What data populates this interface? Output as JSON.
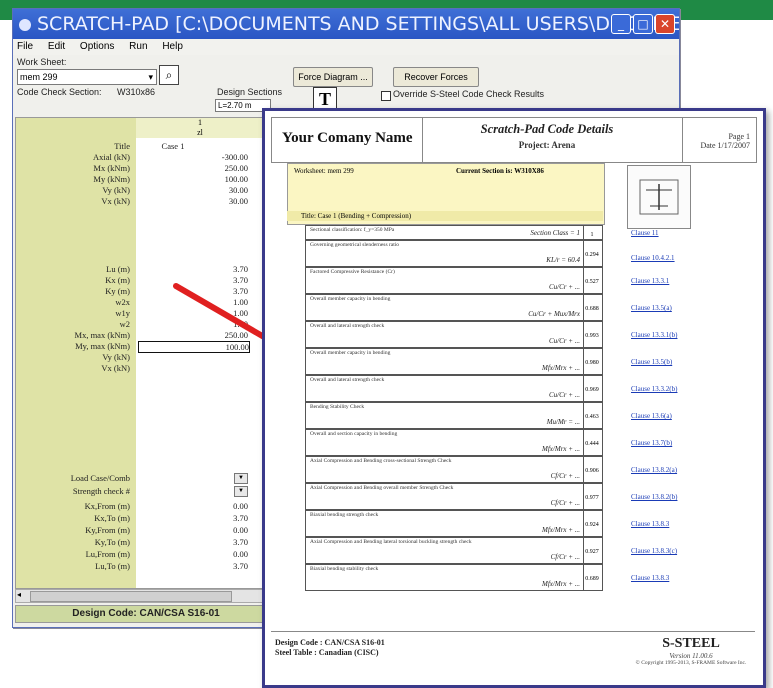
{
  "window": {
    "title": "SCRATCH-PAD [C:\\DOCUMENTS AND SETTINGS\\ALL USERS\\DOCUMENTS\\...",
    "menu": [
      "File",
      "Edit",
      "Options",
      "Run",
      "Help"
    ]
  },
  "toolbar": {
    "worksheet_label": "Work Sheet:",
    "worksheet_value": "mem 299",
    "code_check_section_label": "Code Check Section:",
    "code_check_section_value": "W310x86",
    "design_sections_label": "Design Sections",
    "design_sections_value": "L=2.70 m",
    "force_diagram": "Force Diagram ...",
    "recover_forces": "Recover Forces",
    "override_label": "Override S-Steel Code Check Results"
  },
  "grid": {
    "col_index": "1",
    "col_sub": "zl",
    "rows_top": [
      {
        "label": "Title",
        "value": "Case 1"
      },
      {
        "label": "Axial (kN)",
        "value": "-300.00"
      },
      {
        "label": "Mx (kNm)",
        "value": "250.00"
      },
      {
        "label": "My (kNm)",
        "value": "100.00"
      },
      {
        "label": "Vy (kN)",
        "value": "30.00"
      },
      {
        "label": "Vx (kN)",
        "value": "30.00"
      }
    ],
    "rows_mid": [
      {
        "label": "Lu (m)",
        "value": "3.70"
      },
      {
        "label": "Kx (m)",
        "value": "3.70"
      },
      {
        "label": "Ky (m)",
        "value": "3.70"
      },
      {
        "label": "w2x",
        "value": "1.00"
      },
      {
        "label": "w1y",
        "value": "1.00"
      },
      {
        "label": "w2",
        "value": "1.00"
      },
      {
        "label": "Mx, max (kNm)",
        "value": "250.00"
      },
      {
        "label": "My, max (kNm)",
        "value": "100.00"
      },
      {
        "label": "Vy (kN)",
        "value": ""
      },
      {
        "label": "Vx (kN)",
        "value": ""
      }
    ],
    "rows_bottom": [
      {
        "label": "Load Case/Comb",
        "value": ""
      },
      {
        "label": "Strength check #",
        "value": ""
      },
      {
        "label": "Kx,From (m)",
        "value": "0.00"
      },
      {
        "label": "Kx,To (m)",
        "value": "3.70"
      },
      {
        "label": "Ky,From (m)",
        "value": "0.00"
      },
      {
        "label": "Ky,To (m)",
        "value": "3.70"
      },
      {
        "label": "Lu,From (m)",
        "value": "0.00"
      },
      {
        "label": "Lu,To (m)",
        "value": "3.70"
      }
    ],
    "status": "Design Code: CAN/CSA S16-01"
  },
  "report": {
    "company": "Your Comany Name",
    "title": "Scratch-Pad Code Details",
    "subtitle": "Project: Arena",
    "page": "Page 1",
    "date": "Date 1/17/2007",
    "worksheet": "Worksheet: mem 299",
    "current_section": "Current Section is: W310X86",
    "case_title": "Title: Case 1  (Bending + Compression)",
    "formulas": [
      {
        "desc": "Sectional classification:  f_y=350 MPa",
        "eq": "Section Class = 1",
        "res": "1"
      },
      {
        "desc": "Governing geometrical slenderness ratio",
        "eq": "KL/r = 60.4",
        "res": "0.294"
      },
      {
        "desc": "Factored Compressive Resistance (Cr)",
        "eq": "Cu/Cr + ...",
        "res": "0.527"
      },
      {
        "desc": "Overall member capacity in bending",
        "eq": "Cu/Cr + Mux/Mrx",
        "res": "0.688"
      },
      {
        "desc": "Overall and lateral strength check",
        "eq": "Cu/Cr + ...",
        "res": "0.993"
      },
      {
        "desc": "Overall member capacity in bending",
        "eq": "Mfx/Mrx + ...",
        "res": "0.980"
      },
      {
        "desc": "Overall and lateral strength check",
        "eq": "Cu/Cr + ...",
        "res": "0.969"
      },
      {
        "desc": "Bending Stability Check",
        "eq": "Mu/Mr = ...",
        "res": "0.463"
      },
      {
        "desc": "Overall and section capacity in bending",
        "eq": "Mfx/Mrx + ...",
        "res": "0.444"
      },
      {
        "desc": "Axial Compression and Bending cross-sectional Strength Check",
        "eq": "Cf/Cr + ...",
        "res": "0.906"
      },
      {
        "desc": "Axial Compression and Bending overall member Strength Check",
        "eq": "Cf/Cr + ...",
        "res": "0.977"
      },
      {
        "desc": "Biaxial bending strength check",
        "eq": "Mfx/Mrx + ...",
        "res": "0.924"
      },
      {
        "desc": "Axial Compression and Bending lateral torsional buckling strength check",
        "eq": "Cf/Cr + ...",
        "res": "0.927"
      },
      {
        "desc": "Biaxial bending stability check",
        "eq": "Mfx/Mrx + ...",
        "res": "0.689"
      }
    ],
    "clauses": [
      "Clause 11",
      "Clause 10.4.2.1",
      "Clause 13.3.1",
      "Clause 13.5(a)",
      "Clause 13.3.1(b)",
      "Clause 13.5(b)",
      "Clause 13.3.2(b)",
      "Clause 13.6(a)",
      "Clause 13.7(b)",
      "Clause 13.8.2(a)",
      "Clause 13.8.2(b)",
      "Clause 13.8.3",
      "Clause 13.8.3(c)",
      "Clause 13.8.3"
    ],
    "design_code": "Design Code : CAN/CSA S16-01",
    "steel_table": "Steel Table : Canadian (CISC)",
    "brand": "S-STEEL",
    "version": "Version 11.00.6",
    "copyright": "© Copyright 1995-2013, S-FRAME Software Inc."
  },
  "colors": {
    "accent": "#1f8a45",
    "titlebar": "#2a56c4",
    "grid_label": "#dfe3a6",
    "arrow": "#e02020"
  }
}
